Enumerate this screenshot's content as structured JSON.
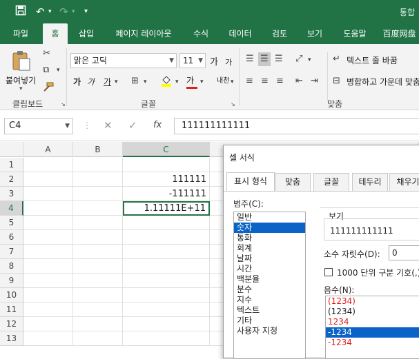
{
  "titlebar": {
    "title": "통합"
  },
  "ribbon_tabs": [
    "파일",
    "홈",
    "삽입",
    "페이지 레이아웃",
    "수식",
    "데이터",
    "검토",
    "보기",
    "도움말",
    "百度网盘"
  ],
  "clipboard": {
    "paste_label": "붙여넣기",
    "group_label": "클립보드"
  },
  "font": {
    "name": "맑은 고딕",
    "size": "11",
    "grow": "가",
    "shrink": "가",
    "bold": "가",
    "italic": "가",
    "underline": "가",
    "color_letter": "가",
    "phonetic": "내천",
    "group_label": "글꼴"
  },
  "alignment": {
    "wrap_text": "텍스트 줄 바꿈",
    "merge_center": "병합하고 가운데 맞춤",
    "group_label": "맞춤"
  },
  "formula_bar": {
    "name_box": "C4",
    "fx": "fx",
    "value": "111111111111"
  },
  "grid": {
    "columns": [
      "A",
      "B",
      "C"
    ],
    "rows": [
      "1",
      "2",
      "3",
      "4",
      "5",
      "6",
      "7",
      "8",
      "9",
      "10",
      "11",
      "12",
      "13"
    ],
    "cells": [
      {
        "ref": "C2",
        "value": "111111"
      },
      {
        "ref": "C3",
        "value": "-111111"
      },
      {
        "ref": "C4",
        "value": "1.11111E+11"
      }
    ]
  },
  "dialog": {
    "title": "셀 서식",
    "tabs": [
      "표시 형식",
      "맞춤",
      "글꼴",
      "테두리",
      "채우기"
    ],
    "category_label": "범주(C):",
    "categories": [
      "일반",
      "숫자",
      "통화",
      "회계",
      "날짜",
      "시간",
      "백분율",
      "분수",
      "지수",
      "텍스트",
      "기타",
      "사용자 지정"
    ],
    "selected_category": "숫자",
    "sample_label": "보기",
    "sample_value": "111111111111",
    "decimal_label": "소수 자릿수(D):",
    "decimal_value": "0",
    "thousands_label": "1000 단위 구분 기호(,)",
    "negative_label": "음수(N):",
    "negative_options": [
      {
        "text": "(1234)",
        "color": "#e02020"
      },
      {
        "text": "(1234)",
        "color": "#222222"
      },
      {
        "text": "1234",
        "color": "#e02020"
      },
      {
        "text": "-1234",
        "color": "#ffffff",
        "selected": true
      },
      {
        "text": "-1234",
        "color": "#e02020"
      }
    ]
  },
  "colors": {
    "accent": "#217346",
    "selection": "#0a64c8",
    "negative_red": "#e02020"
  }
}
